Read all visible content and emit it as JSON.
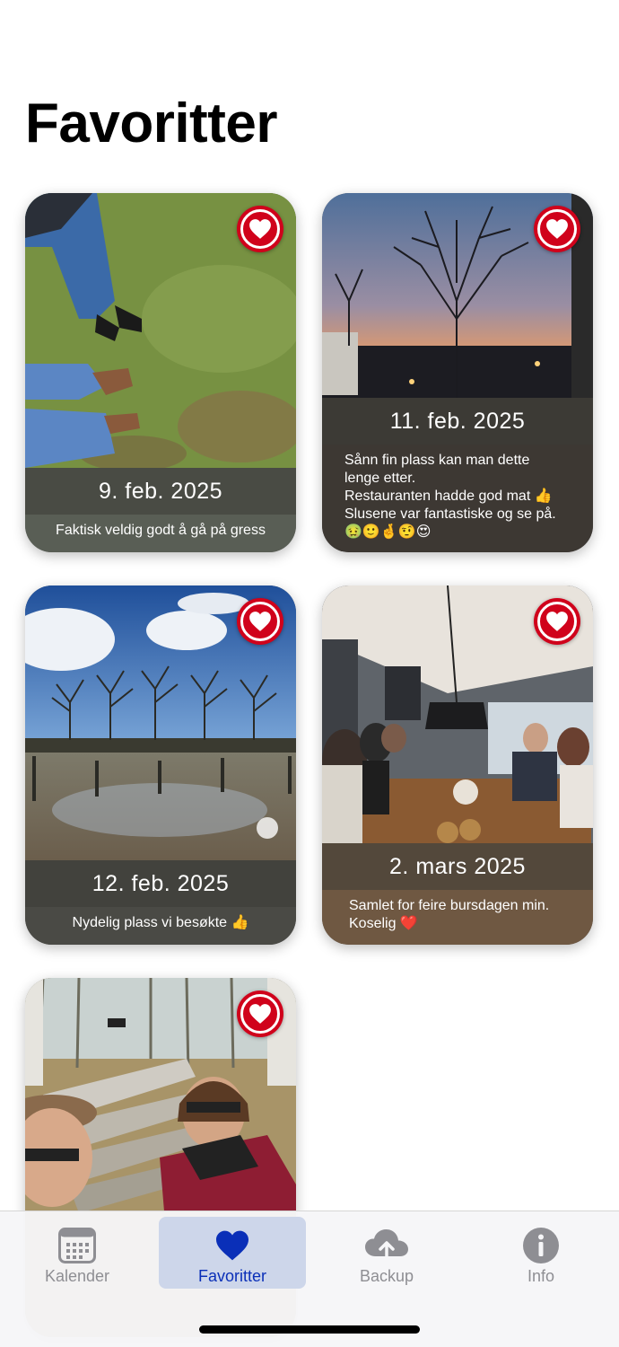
{
  "page": {
    "title": "Favoritter"
  },
  "cards": [
    {
      "date": "9. feb. 2025",
      "note": "Faktisk veldig godt å gå på gress",
      "favorite": true,
      "image": "feet on grass"
    },
    {
      "date": "11. feb. 2025",
      "note": "Sånn fin plass kan man dette\nlenge etter.\nRestauranten hadde god mat 👍\nSlusene var fantastiske og se på.\n🤢🙂🤞🤨😍",
      "favorite": true,
      "image": "sunset behind bare tree"
    },
    {
      "date": "12. feb. 2025",
      "note": "Nydelig plass vi besøkte 👍",
      "favorite": true,
      "image": "trees reflected in water"
    },
    {
      "date": "2. mars 2025",
      "note": "Samlet for feire bursdagen min.\nKoselig ❤️",
      "favorite": true,
      "image": "family dinner table"
    },
    {
      "favorite": true,
      "image": "selfie on park bench"
    }
  ],
  "tabbar": {
    "tabs": [
      {
        "label": "Kalender",
        "icon": "calendar-icon",
        "active": false
      },
      {
        "label": "Favoritter",
        "icon": "heart-icon",
        "active": true
      },
      {
        "label": "Backup",
        "icon": "cloud-upload-icon",
        "active": false
      },
      {
        "label": "Info",
        "icon": "info-icon",
        "active": false
      }
    ]
  },
  "colors": {
    "accent": "#0a2fb8",
    "heart": "#d0021b",
    "inactive": "#8e8e93"
  }
}
